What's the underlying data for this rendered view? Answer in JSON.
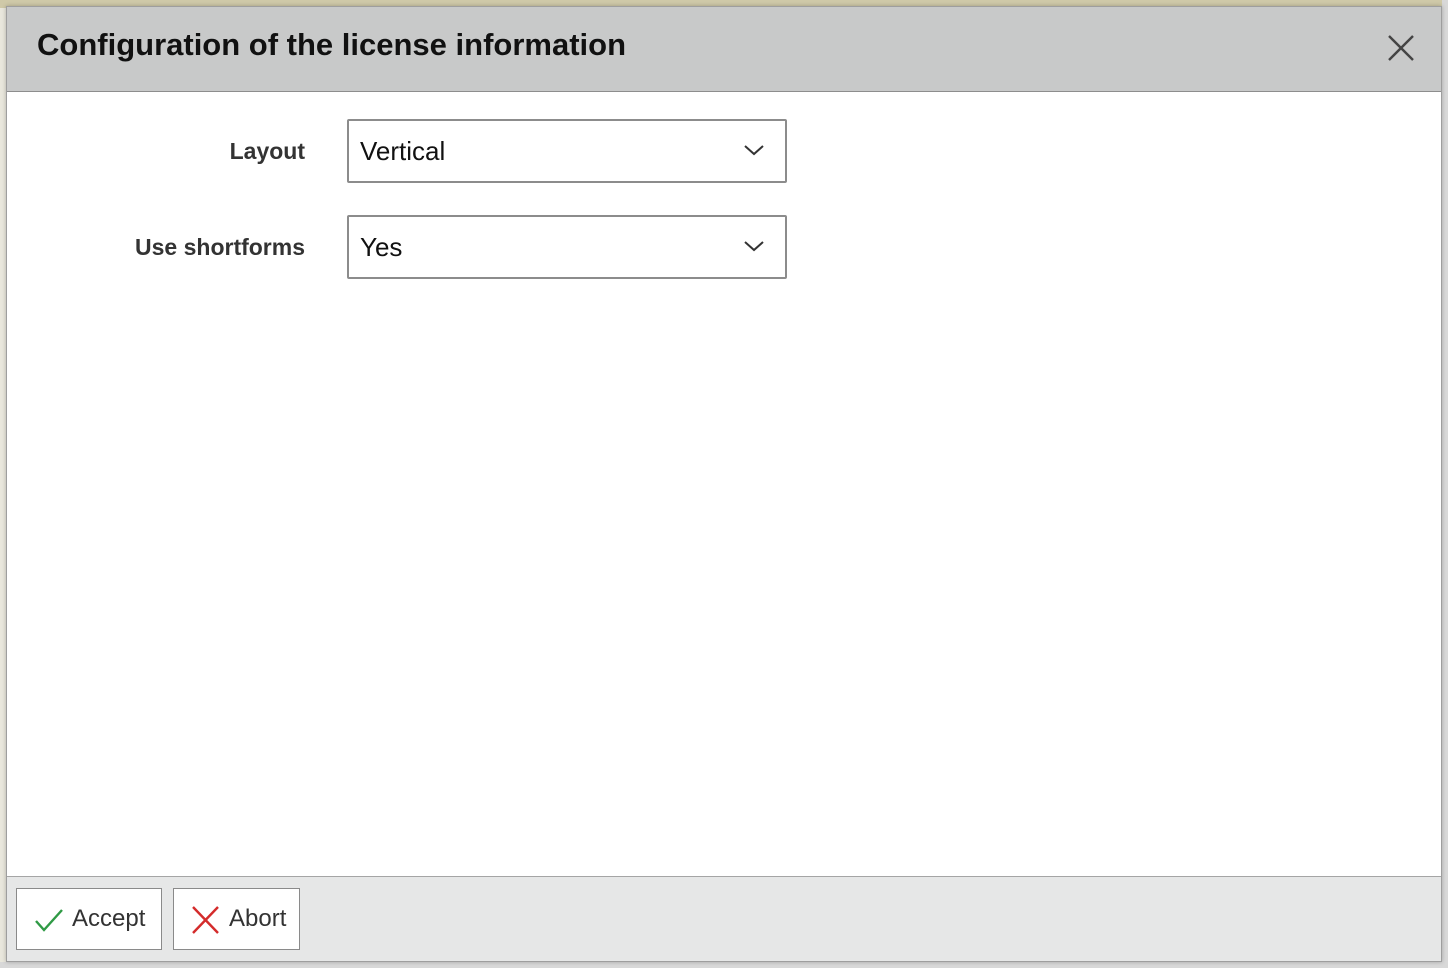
{
  "dialog": {
    "title": "Configuration of the license information",
    "close_icon": "close-icon"
  },
  "form": {
    "fields": [
      {
        "label": "Layout",
        "value": "Vertical"
      },
      {
        "label": "Use shortforms",
        "value": "Yes"
      }
    ]
  },
  "footer": {
    "accept_label": "Accept",
    "abort_label": "Abort"
  },
  "colors": {
    "header_bg": "#c8c9c9",
    "footer_bg": "#e6e7e7",
    "accept_icon": "#2f9a45",
    "abort_icon": "#d42b2b"
  }
}
